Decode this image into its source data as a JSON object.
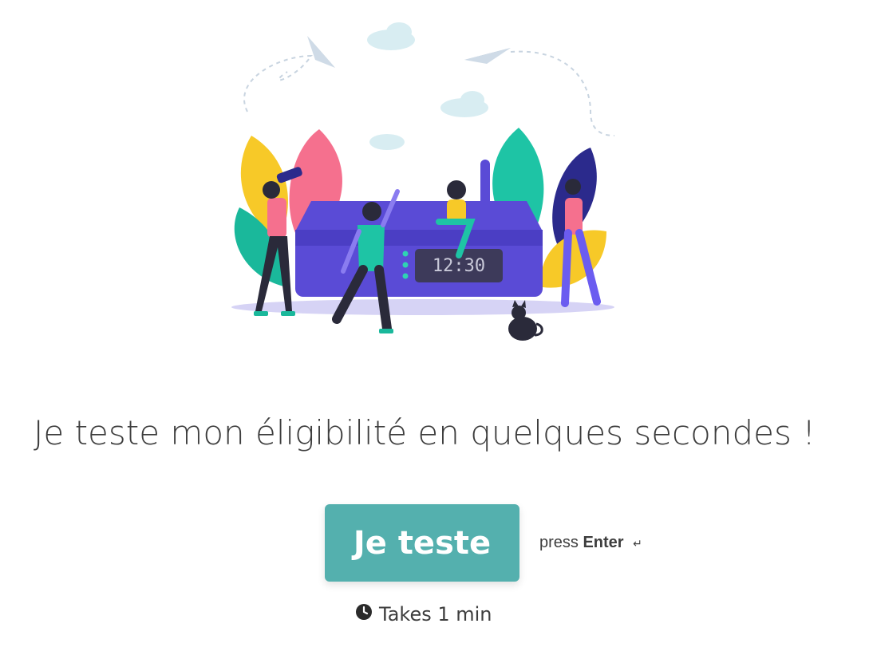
{
  "hero": {
    "illustration": "router-party-illustration",
    "clock_display": "12:30"
  },
  "headline": "Je teste mon éligibilité en quelques secondes !",
  "cta": {
    "label": "Je teste",
    "hint_prefix": "press",
    "hint_key": "Enter",
    "hint_icon": "↵",
    "color": "#54b0ae"
  },
  "duration": {
    "icon": "clock-icon",
    "text": "Takes 1 min"
  }
}
